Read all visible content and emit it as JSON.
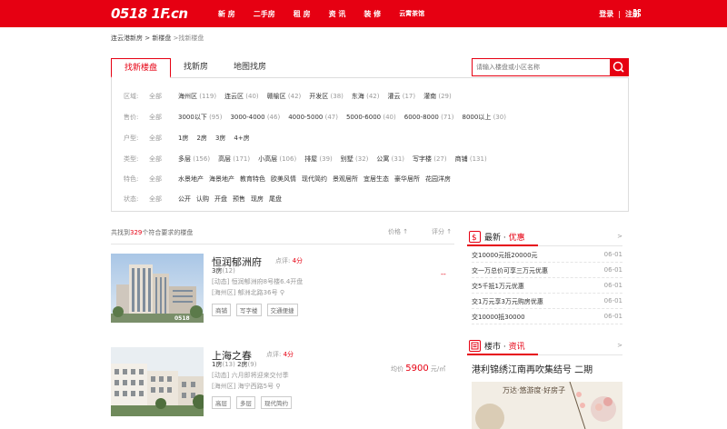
{
  "header": {
    "logo": "0518 1F.cn",
    "nav": [
      "新 房",
      "二手房",
      "租 房",
      "资 讯",
      "装 修",
      "云霄茶馆"
    ],
    "login": "登录",
    "sep": "|",
    "register": "注册"
  },
  "breadcrumb": {
    "home": "连云港新房",
    "sep1": " > ",
    "list": "新楼盘",
    "sep2": " >",
    "current": "找新楼盘"
  },
  "tabs": [
    "找新楼盘",
    "找新房",
    "地图找房"
  ],
  "search": {
    "placeholder": "请输入楼盘或小区名称"
  },
  "filters": [
    {
      "label": "区域:",
      "all": "全部",
      "options": [
        {
          "name": "海州区",
          "count": "(119)"
        },
        {
          "name": "连云区",
          "count": "(40)"
        },
        {
          "name": "赣榆区",
          "count": "(42)"
        },
        {
          "name": "开发区",
          "count": "(38)"
        },
        {
          "name": "东海",
          "count": "(42)"
        },
        {
          "name": "灌云",
          "count": "(17)"
        },
        {
          "name": "灌南",
          "count": "(29)"
        }
      ]
    },
    {
      "label": "售价:",
      "all": "全部",
      "options": [
        {
          "name": "3000以下",
          "count": "(95)"
        },
        {
          "name": "3000-4000",
          "count": "(46)"
        },
        {
          "name": "4000-5000",
          "count": "(47)"
        },
        {
          "name": "5000-6000",
          "count": "(40)"
        },
        {
          "name": "6000-8000",
          "count": "(71)"
        },
        {
          "name": "8000以上",
          "count": "(30)"
        }
      ]
    },
    {
      "label": "户型:",
      "all": "全部",
      "options": [
        {
          "name": "1房",
          "count": ""
        },
        {
          "name": "2房",
          "count": ""
        },
        {
          "name": "3房",
          "count": ""
        },
        {
          "name": "4+房",
          "count": ""
        }
      ]
    },
    {
      "label": "类型:",
      "all": "全部",
      "options": [
        {
          "name": "多层",
          "count": "(156)"
        },
        {
          "name": "高层",
          "count": "(171)"
        },
        {
          "name": "小高层",
          "count": "(106)"
        },
        {
          "name": "排屋",
          "count": "(39)"
        },
        {
          "name": "别墅",
          "count": "(32)"
        },
        {
          "name": "公寓",
          "count": "(31)"
        },
        {
          "name": "写字楼",
          "count": "(27)"
        },
        {
          "name": "商铺",
          "count": "(131)"
        }
      ]
    },
    {
      "label": "特色:",
      "all": "全部",
      "options": [
        {
          "name": "水景地产",
          "count": ""
        },
        {
          "name": "海景地产",
          "count": ""
        },
        {
          "name": "教育特色",
          "count": ""
        },
        {
          "name": "欧美风情",
          "count": ""
        },
        {
          "name": "现代简约",
          "count": ""
        },
        {
          "name": "景观居所",
          "count": ""
        },
        {
          "name": "宜居生态",
          "count": ""
        },
        {
          "name": "豪华居所",
          "count": ""
        },
        {
          "name": "花园洋房",
          "count": ""
        }
      ]
    },
    {
      "label": "状态:",
      "all": "全部",
      "options": [
        {
          "name": "公开",
          "count": ""
        },
        {
          "name": "认购",
          "count": ""
        },
        {
          "name": "开盘",
          "count": ""
        },
        {
          "name": "预售",
          "count": ""
        },
        {
          "name": "现房",
          "count": ""
        },
        {
          "name": "尾盘",
          "count": ""
        }
      ]
    }
  ],
  "results": {
    "prefix": "共找到",
    "count": "329",
    "suffix": "个符合要求的楼盘",
    "sort_price": "价格",
    "sort_score": "评分"
  },
  "listings": [
    {
      "title": "恒润郁洲府",
      "score_label": "点评:",
      "score": "4分",
      "rooms": [
        {
          "t": "3房",
          "c": "(12)"
        }
      ],
      "news": "[动态] 恒润郁洲府8号楼6.4开盘",
      "address": "[海州区] 郁洲北路36号",
      "tags": [
        "商铺",
        "写字楼",
        "交通便捷"
      ],
      "price": "--"
    },
    {
      "title": "上海之春",
      "score_label": "点评:",
      "score": "4分",
      "rooms": [
        {
          "t": "1房",
          "c": "(13)"
        },
        {
          "t": "2房",
          "c": "(9)"
        }
      ],
      "news": "[动态] 六月即将迎来交付季",
      "address": "[海州区] 海宁西路5号",
      "tags": [
        "高层",
        "多层",
        "现代简约"
      ],
      "price_label": "均价",
      "price": "5900",
      "price_unit": "元/㎡"
    }
  ],
  "sidebar": {
    "promo_title_a": "最新 · ",
    "promo_title_b": "优惠",
    "arrow": ">",
    "promos": [
      {
        "text": "交10000元抵20000元",
        "date": "06-01"
      },
      {
        "text": "交一万总价可享三万元优惠",
        "date": "06-01"
      },
      {
        "text": "交5千抵1万元优惠",
        "date": "06-01"
      },
      {
        "text": "交1万元享3万元购房优惠",
        "date": "06-01"
      },
      {
        "text": "交10000抵30000",
        "date": "06-01"
      }
    ],
    "market_title_a": "楼市 · ",
    "market_title_b": "资讯",
    "market_headline": "港利锦绣江南再吹集结号 二期",
    "market_img_text": "万达·悠游度·好房子"
  },
  "colors": {
    "brand": "#e60012"
  }
}
